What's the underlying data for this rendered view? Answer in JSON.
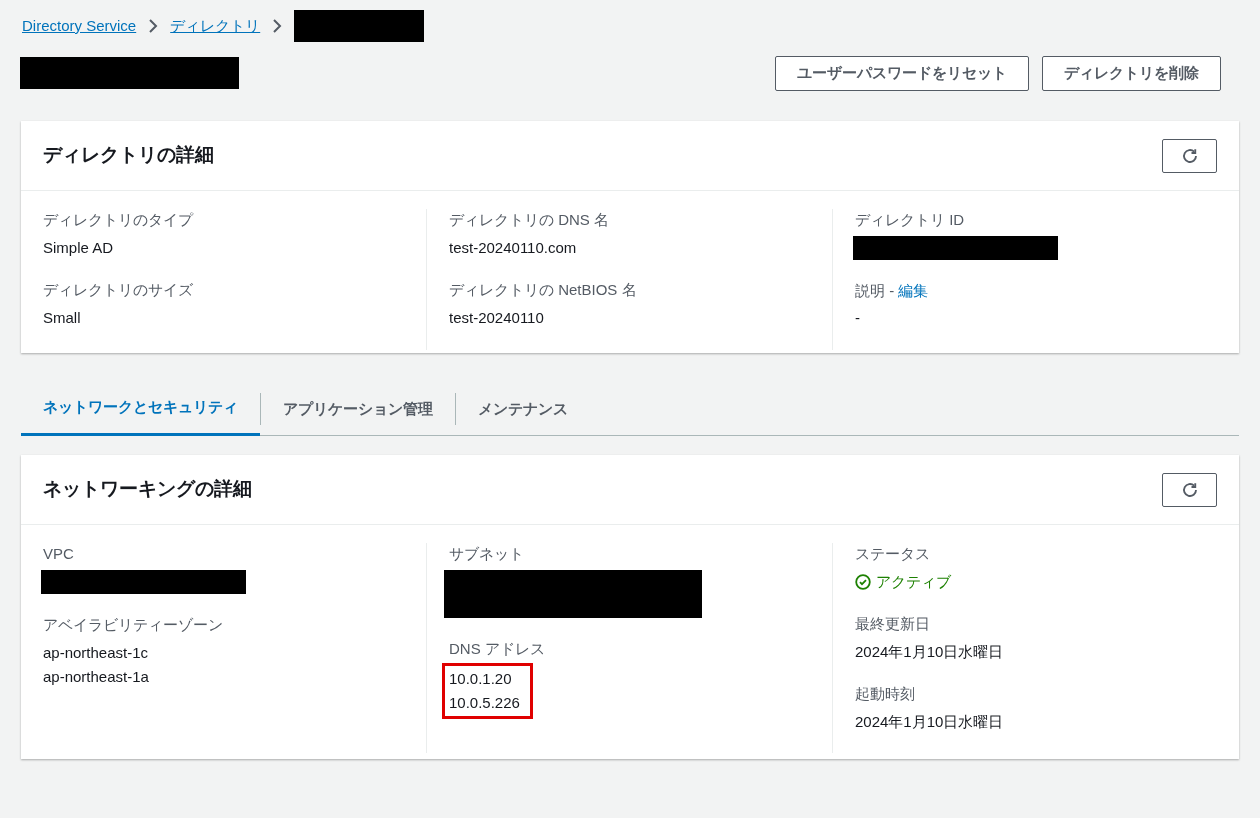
{
  "breadcrumb": [
    {
      "kind": "link",
      "label": "Directory Service"
    },
    {
      "kind": "link",
      "label": "ディレクトリ"
    },
    {
      "kind": "redacted"
    }
  ],
  "header": {
    "buttons": [
      "ユーザーパスワードをリセット",
      "ディレクトリを削除"
    ]
  },
  "details": {
    "title": "ディレクトリの詳細",
    "columns": [
      [
        {
          "kind": "text",
          "label": "ディレクトリのタイプ",
          "value": "Simple AD"
        },
        {
          "kind": "text",
          "label": "ディレクトリのサイズ",
          "value": "Small"
        }
      ],
      [
        {
          "kind": "text",
          "label": "ディレクトリの DNS 名",
          "value": "test-20240110.com"
        },
        {
          "kind": "text",
          "label": "ディレクトリの NetBIOS 名",
          "value": "test-20240110"
        }
      ],
      [
        {
          "kind": "redacted",
          "label": "ディレクトリ ID"
        },
        {
          "kind": "text",
          "label": "説明 -",
          "label_link": "編集",
          "value": "-"
        }
      ]
    ]
  },
  "tabs": [
    {
      "label": "ネットワークとセキュリティ",
      "selected": true
    },
    {
      "label": "アプリケーション管理",
      "selected": false
    },
    {
      "label": "メンテナンス",
      "selected": false
    }
  ],
  "networking": {
    "title": "ネットワーキングの詳細",
    "columns": [
      [
        {
          "kind": "redacted",
          "label": "VPC"
        },
        {
          "kind": "lines",
          "label": "アベイラビリティーゾーン",
          "lines": [
            "ap-northeast-1c",
            "ap-northeast-1a"
          ],
          "highlighted": false
        }
      ],
      [
        {
          "kind": "redacted_tall",
          "label": "サブネット"
        },
        {
          "kind": "lines",
          "label": "DNS アドレス",
          "lines": [
            "10.0.1.20",
            "10.0.5.226"
          ],
          "highlighted": true
        }
      ],
      [
        {
          "kind": "status",
          "label": "ステータス",
          "value": "アクティブ",
          "color": "#1d8102"
        },
        {
          "kind": "text",
          "label": "最終更新日",
          "value": "2024年1月10日水曜日"
        },
        {
          "kind": "text",
          "label": "起動時刻",
          "value": "2024年1月10日水曜日"
        }
      ]
    ]
  }
}
